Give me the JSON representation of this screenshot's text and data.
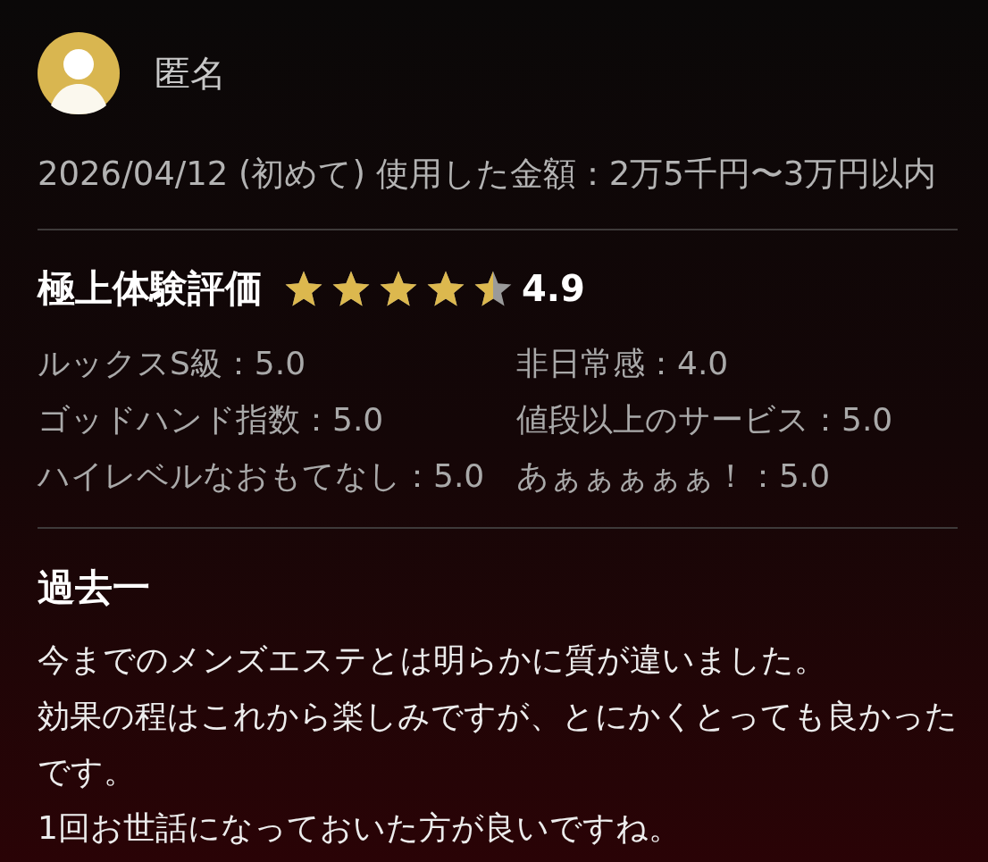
{
  "reviewer": {
    "name": "匿名"
  },
  "meta": "2026/04/12 (初めて) 使用した金額：2万5千円〜3万円以内",
  "rating": {
    "title": "極上体験評価",
    "stars": 4.5,
    "score": "4.9"
  },
  "criteria": [
    "ルックスS級：5.0",
    "非日常感：4.0",
    "ゴッドハンド指数：5.0",
    "値段以上のサービス：5.0",
    "ハイレベルなおもてなし：5.0",
    "あぁぁぁぁぁ！：5.0"
  ],
  "review": {
    "title": "過去一",
    "body": [
      "今までのメンズエステとは明らかに質が違いました。",
      "効果の程はこれから楽しみですが、とにかくとっても良かったです。",
      "1回お世話になっておいた方が良いですね。"
    ]
  }
}
